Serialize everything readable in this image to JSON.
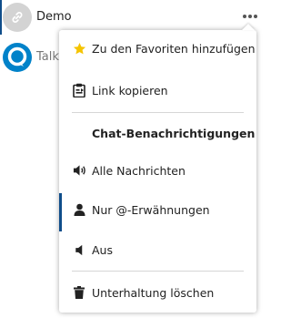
{
  "conversations": [
    {
      "name": "Demo",
      "avatar_icon": "link-icon"
    },
    {
      "name": "Talk",
      "avatar_icon": "talk-logo-icon"
    }
  ],
  "more_button": {
    "icon": "more-dots-icon"
  },
  "menu": {
    "favorite_label": "Zu den Favoriten hinzufügen",
    "copy_link_label": "Link kopieren",
    "notifications_heading": "Chat-Benachrichtigungen",
    "notify_all_label": "Alle Nachrichten",
    "notify_mentions_label": "Nur @-Erwähnungen",
    "notify_off_label": "Aus",
    "delete_label": "Unterhaltung löschen"
  },
  "colors": {
    "accent": "#0f4d8a",
    "star": "#fc0",
    "talk_brand": "#0082c9"
  }
}
